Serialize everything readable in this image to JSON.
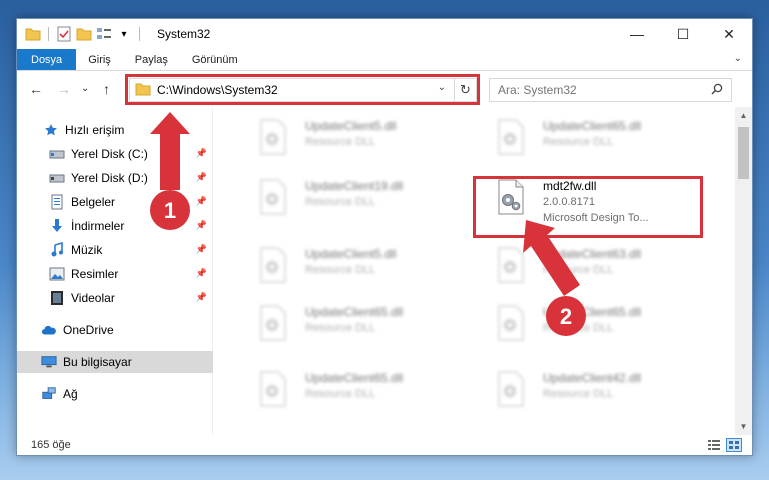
{
  "window": {
    "title": "System32",
    "minimize_glyph": "—",
    "maximize_glyph": "☐",
    "close_glyph": "✕"
  },
  "ribbon": {
    "tabs": [
      "Dosya",
      "Giriş",
      "Paylaş",
      "Görünüm"
    ],
    "expand_glyph": "⌄"
  },
  "nav": {
    "back_glyph": "←",
    "forward_glyph": "→",
    "recent_glyph": "⌄",
    "up_glyph": "↑"
  },
  "address": {
    "path": "C:\\Windows\\System32",
    "dropdown_glyph": "⌄",
    "refresh_glyph": "↻"
  },
  "search": {
    "placeholder": "Ara: System32"
  },
  "sidebar": {
    "items": [
      {
        "label": "Hızlı erişim",
        "icon": "star-icon"
      },
      {
        "label": "Yerel Disk (C:)",
        "icon": "drive-icon",
        "pinned": true
      },
      {
        "label": "Yerel Disk (D:)",
        "icon": "drive-icon",
        "pinned": true
      },
      {
        "label": "Belgeler",
        "icon": "documents-icon",
        "pinned": true
      },
      {
        "label": "İndirmeler",
        "icon": "download-icon",
        "pinned": true
      },
      {
        "label": "Müzik",
        "icon": "music-icon",
        "pinned": true
      },
      {
        "label": "Resimler",
        "icon": "pictures-icon",
        "pinned": true
      },
      {
        "label": "Videolar",
        "icon": "videos-icon",
        "pinned": true
      },
      {
        "label": "OneDrive",
        "icon": "cloud-icon"
      },
      {
        "label": "Bu bilgisayar",
        "icon": "computer-icon",
        "selected": true
      },
      {
        "label": "Ağ",
        "icon": "network-icon"
      }
    ],
    "pin_glyph": "📌"
  },
  "files": [
    {
      "name": "UpdateClient5.dll",
      "desc": "Resource DLL",
      "blurred": true
    },
    {
      "name": "UpdateClient65.dll",
      "desc": "Resource DLL",
      "blurred": true
    },
    {
      "name": "UpdateClient19.dll",
      "desc": "Resource DLL",
      "blurred": true
    },
    {
      "name": "mdt2fw.dll",
      "version": "2.0.0.8171",
      "desc": "Microsoft Design To...",
      "blurred": false
    },
    {
      "name": "UpdateClient5.dll",
      "desc": "Resource DLL",
      "blurred": true
    },
    {
      "name": "UpdateClient63.dll",
      "desc": "Resource DLL",
      "blurred": true
    },
    {
      "name": "UpdateClient65.dll",
      "desc": "Resource DLL",
      "blurred": true
    },
    {
      "name": "UpdateClient65.dll",
      "desc": "Resource DLL",
      "blurred": true
    },
    {
      "name": "UpdateClient65.dll",
      "desc": "Resource DLL",
      "blurred": true
    },
    {
      "name": "UpdateClient42.dll",
      "desc": "Resource DLL",
      "blurred": true
    }
  ],
  "status": {
    "count": "165 öğe"
  },
  "annotations": {
    "marker1": "1",
    "marker2": "2",
    "color": "#d8333a"
  }
}
